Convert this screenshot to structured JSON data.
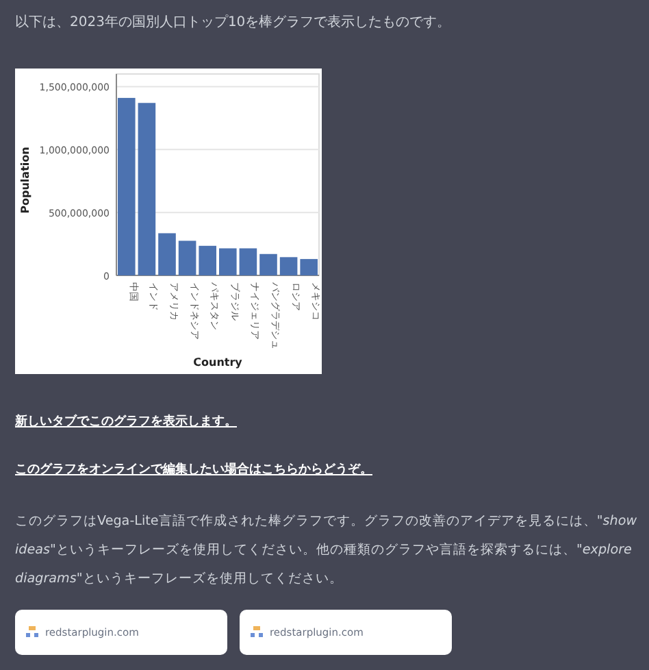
{
  "intro": "以下は、2023年の国別人口トップ10を棒グラフで表示したものです。",
  "chart": {
    "chart_data": {
      "type": "bar",
      "xlabel": "Country",
      "ylabel": "Population",
      "categories": [
        "中国",
        "インド",
        "アメリカ",
        "インドネシア",
        "パキスタン",
        "ブラジル",
        "ナイジェリア",
        "バングラデシュ",
        "ロシア",
        "メキシコ"
      ],
      "values": [
        1410000000,
        1370000000,
        335000000,
        275000000,
        235000000,
        215000000,
        215000000,
        170000000,
        145000000,
        130000000
      ],
      "grid": true,
      "ylim": [
        0,
        1600000000
      ],
      "yticks": [
        {
          "value": 0,
          "label": "0"
        },
        {
          "value": 500000000,
          "label": "500,000,000"
        },
        {
          "value": 1000000000,
          "label": "1,000,000,000"
        },
        {
          "value": 1500000000,
          "label": "1,500,000,000"
        }
      ]
    }
  },
  "links": [
    "新しいタブでこのグラフを表示します。",
    "このグラフをオンラインで編集したい場合はこちらからどうぞ。"
  ],
  "paragraph": "このグラフはVega-Lite言語で作成された棒グラフです。グラフの改善のアイデアを見るには、\"*show ideas*\"というキーフレーズを使用してください。他の種類のグラフや言語を探索するには、\"*explore diagrams*\"というキーフレーズを使用してください。",
  "cards": [
    {
      "domain": "redstarplugin.com"
    },
    {
      "domain": "redstarplugin.com"
    }
  ]
}
